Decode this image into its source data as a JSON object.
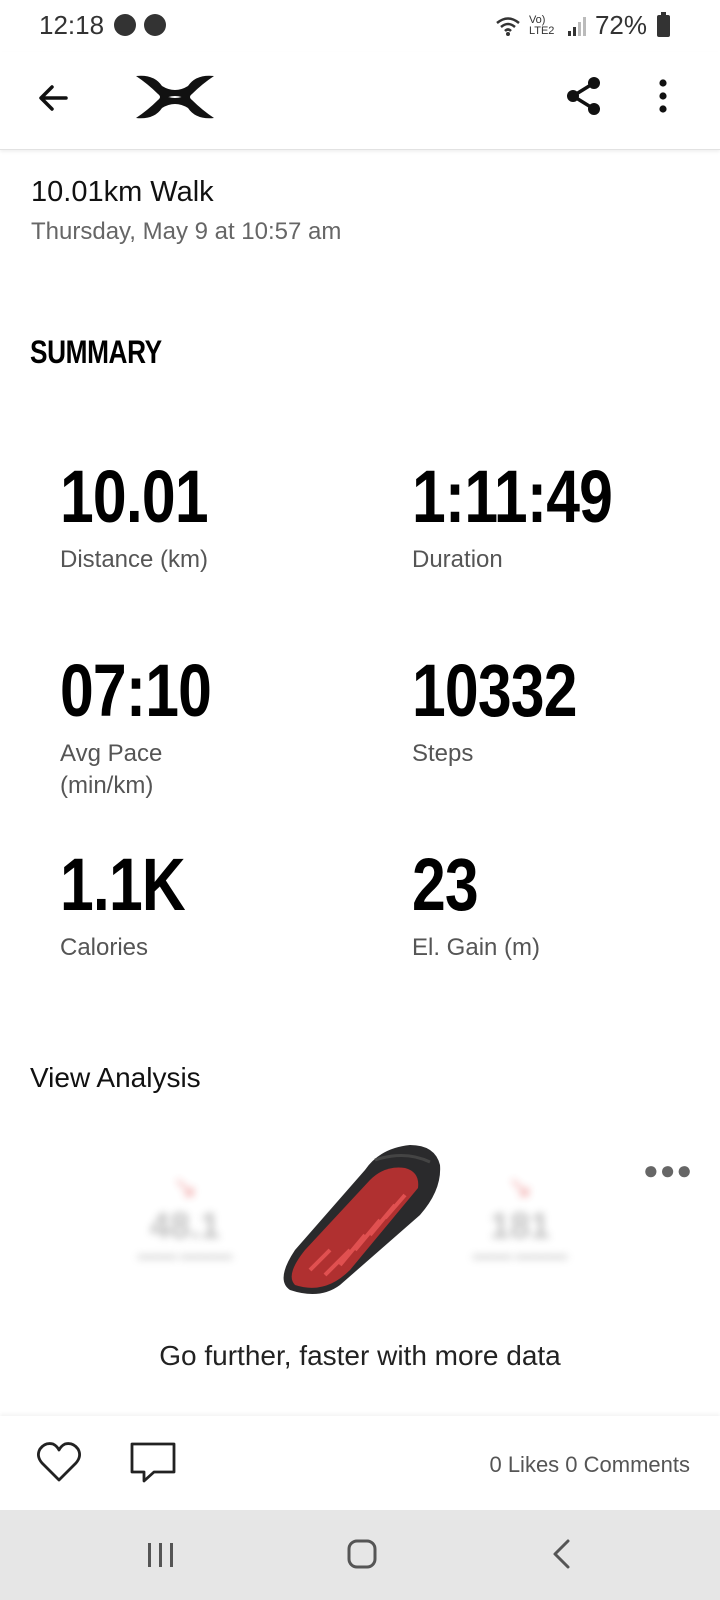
{
  "status_bar": {
    "time": "12:18",
    "network": "Vo) LTE2",
    "battery": "72%"
  },
  "app_bar": {
    "brand": "Under Armour"
  },
  "workout": {
    "title": "10.01km Walk",
    "date": "Thursday, May 9 at 10:57 am"
  },
  "summary": {
    "heading": "SUMMARY",
    "stats": [
      {
        "value": "10.01",
        "label": "Distance (km)"
      },
      {
        "value": "1:11:49",
        "label": "Duration"
      },
      {
        "value": "07:10",
        "label": "Avg Pace (min/km)"
      },
      {
        "value": "10332",
        "label": "Steps"
      },
      {
        "value": "1.1K",
        "label": "Calories"
      },
      {
        "value": "23",
        "label": "El. Gain (m)"
      }
    ]
  },
  "view_analysis": "View Analysis",
  "promo": {
    "blurred_left_value": "48.1",
    "blurred_right_value": "181",
    "text": "Go further, faster with more data"
  },
  "social": {
    "counts": "0 Likes 0 Comments"
  },
  "colors": {
    "accent_red": "#e04040",
    "text_dark": "#111111",
    "text_gray": "#555555",
    "nav_bg": "#e6e6e6"
  }
}
